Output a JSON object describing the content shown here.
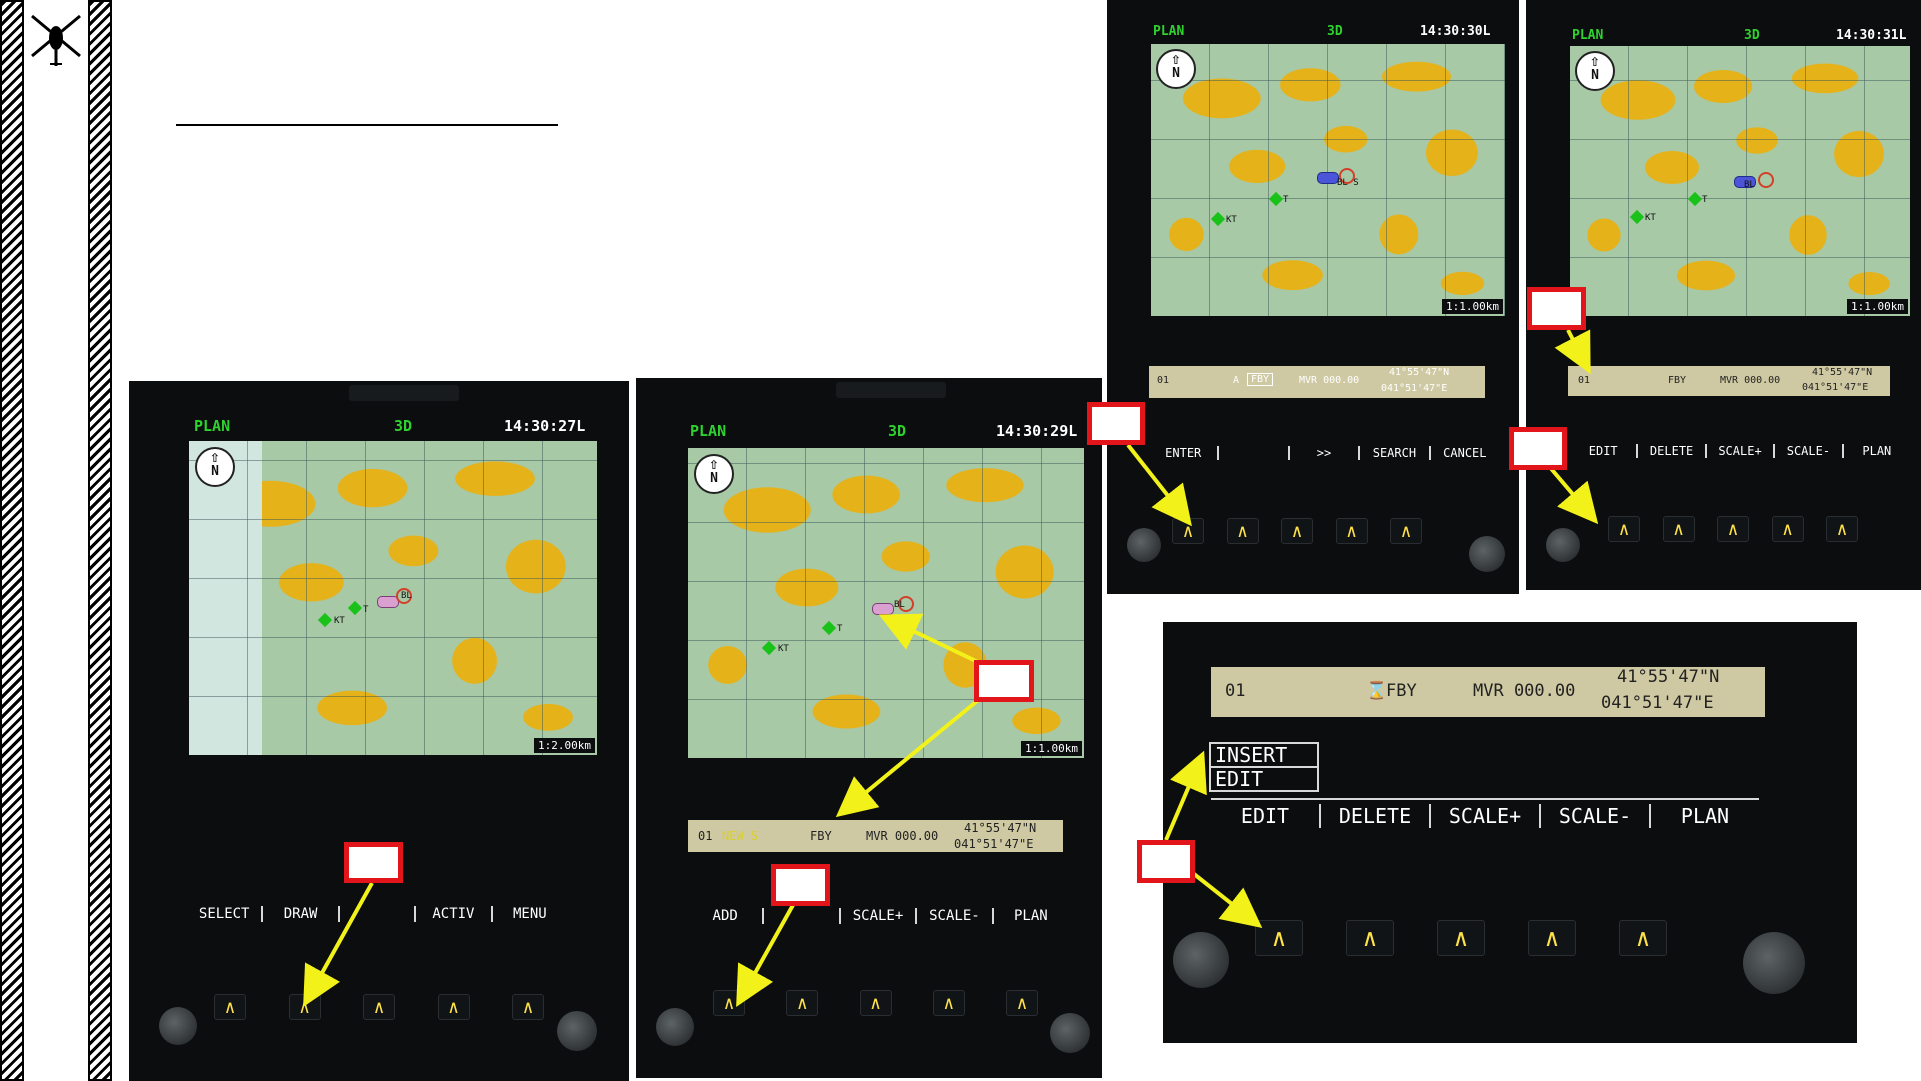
{
  "panel1": {
    "header": {
      "mode": "PLAN",
      "view": "3D",
      "time": "14:30:27L"
    },
    "map": {
      "compass": "N",
      "scale": "1:2.00km",
      "waypoints": [
        "KT",
        "T"
      ],
      "target_label": "BL"
    },
    "softkeys": [
      "SELECT",
      "DRAW",
      "",
      "ACTIV",
      "MENU"
    ],
    "button_glyph": "∧"
  },
  "panel2": {
    "header": {
      "mode": "PLAN",
      "view": "3D",
      "time": "14:30:29L"
    },
    "map": {
      "compass": "N",
      "scale": "1:1.00km",
      "waypoints": [
        "KT",
        "T"
      ],
      "target_label": "BL"
    },
    "dataline": {
      "index": "01",
      "name": "NEW S",
      "type": "FBY",
      "mvr": "MVR 000.00",
      "lat": "41°55'47\"N",
      "lon": "041°51'47\"E"
    },
    "softkeys": [
      "ADD",
      "",
      "SCALE+",
      "SCALE-",
      "PLAN"
    ],
    "button_glyph": "∧"
  },
  "panel3": {
    "header": {
      "mode": "PLAN",
      "view": "3D",
      "time": "14:30:30L"
    },
    "map": {
      "compass": "N",
      "scale": "1:1.00km",
      "waypoints": [
        "KT",
        "T"
      ],
      "target_label": "BL S"
    },
    "dataline": {
      "index": "01",
      "prefix": "A",
      "type": "FBY",
      "mvr": "MVR 000.00",
      "lat": "41°55'47\"N",
      "lon": "041°51'47\"E"
    },
    "softkeys": [
      "ENTER",
      "",
      ">>",
      "SEARCH",
      "CANCEL"
    ],
    "button_glyph": "∧"
  },
  "panel4": {
    "header": {
      "mode": "PLAN",
      "view": "3D",
      "time": "14:30:31L"
    },
    "map": {
      "compass": "N",
      "scale": "1:1.00km",
      "waypoints": [
        "KT",
        "T"
      ],
      "target_label": "BL"
    },
    "dataline": {
      "index": "01",
      "type": "FBY",
      "mvr": "MVR 000.00",
      "lat": "41°55'47\"N",
      "lon": "041°51'47\"E"
    },
    "softkeys": [
      "EDIT",
      "DELETE",
      "SCALE+",
      "SCALE-",
      "PLAN"
    ],
    "button_glyph": "∧"
  },
  "panel5": {
    "dataline": {
      "index": "01",
      "type": "FBY",
      "mvr": "MVR 000.00",
      "lat": "41°55'47\"N",
      "lon": "041°51'47\"E"
    },
    "popup_menu": [
      "INSERT",
      "EDIT"
    ],
    "softkeys": [
      "EDIT",
      "DELETE",
      "SCALE+",
      "SCALE-",
      "PLAN"
    ],
    "button_glyph": "∧"
  },
  "colors": {
    "callout_border": "#e2151b",
    "arrow": "#f2f21a",
    "plan_green": "#2fd12f",
    "button_glyph": "#ffe14a"
  }
}
